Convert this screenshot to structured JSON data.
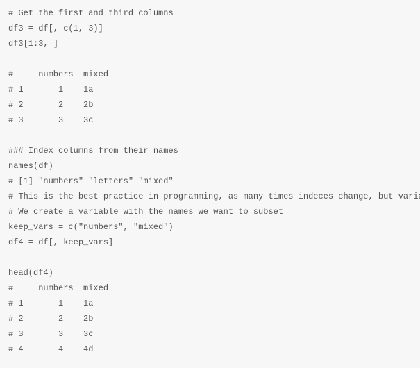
{
  "lines": [
    "# Get the first and third columns",
    "df3 = df[, c(1, 3)]",
    "df3[1:3, ]",
    "",
    "#     numbers  mixed",
    "# 1       1    1a",
    "# 2       2    2b",
    "# 3       3    3c",
    "",
    "### Index columns from their names",
    "names(df)",
    "# [1] \"numbers\" \"letters\" \"mixed\"",
    "# This is the best practice in programming, as many times indeces change, but variable names don't",
    "# We create a variable with the names we want to subset",
    "keep_vars = c(\"numbers\", \"mixed\")",
    "df4 = df[, keep_vars]",
    "",
    "head(df4)",
    "#     numbers  mixed",
    "# 1       1    1a",
    "# 2       2    2b",
    "# 3       3    3c",
    "# 4       4    4d"
  ]
}
